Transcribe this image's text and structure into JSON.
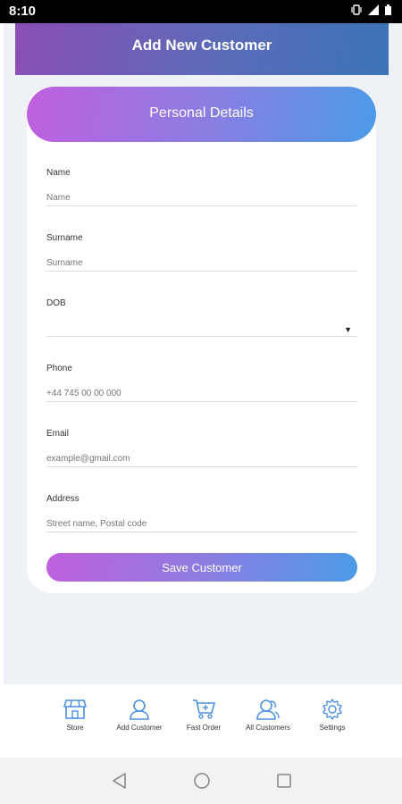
{
  "status_bar": {
    "time": "8:10"
  },
  "header": {
    "title": "Add New Customer"
  },
  "card": {
    "title": "Personal Details"
  },
  "form": {
    "fields": [
      {
        "label": "Name",
        "placeholder": "Name"
      },
      {
        "label": "Surname",
        "placeholder": "Surname"
      },
      {
        "label": "DOB",
        "placeholder": ""
      },
      {
        "label": "Phone",
        "placeholder": "+44 745 00 00 000"
      },
      {
        "label": "Email",
        "placeholder": "example@gmail.com"
      },
      {
        "label": "Address",
        "placeholder": "Street name, Postal code"
      }
    ],
    "dob_arrow": "▼",
    "save_label": "Save Customer"
  },
  "bottom_nav": {
    "items": [
      {
        "label": "Store",
        "icon": "store-icon"
      },
      {
        "label": "Add Customer",
        "icon": "add-customer-icon"
      },
      {
        "label": "Fast Order",
        "icon": "cart-icon"
      },
      {
        "label": "All Customers",
        "icon": "customers-icon"
      },
      {
        "label": "Settings",
        "icon": "gear-icon"
      }
    ]
  },
  "colors": {
    "accent_blue": "#4a90e2",
    "gradient_start": "#c05fe0",
    "gradient_end": "#4b9be6"
  }
}
